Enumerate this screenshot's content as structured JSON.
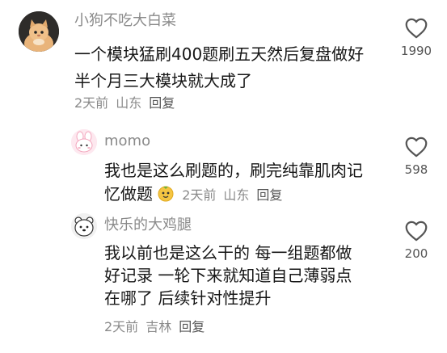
{
  "comments": [
    {
      "username": "小狗不吃大白菜",
      "lines": [
        "一个模块猛刷400题刷五天然后复盘做好",
        "半个月三大模块就大成了"
      ],
      "time": "2天前",
      "location": "山东",
      "reply_label": "回复",
      "likes": "1990",
      "avatar": "cat-avatar"
    },
    {
      "username": "momo",
      "lines": [
        "我也是这么刷题的，刷完纯靠肌肉记",
        "忆做题"
      ],
      "emoji": "fruit-face-emoji",
      "time": "2天前",
      "location": "山东",
      "reply_label": "回复",
      "likes": "598",
      "avatar": "pink-bunny-avatar"
    },
    {
      "username": "快乐的大鸡腿",
      "lines": [
        "我以前也是这么干的 每一组题都做",
        "好记录 一轮下来就知道自己薄弱点",
        "在哪了 后续针对性提升"
      ],
      "time": "2天前",
      "location": "吉林",
      "reply_label": "回复",
      "likes": "200",
      "avatar": "bear-avatar"
    }
  ],
  "colors": {
    "username": "#8a8a8a",
    "text": "#161616",
    "meta": "#8a8a8a",
    "icon": "#555555"
  }
}
